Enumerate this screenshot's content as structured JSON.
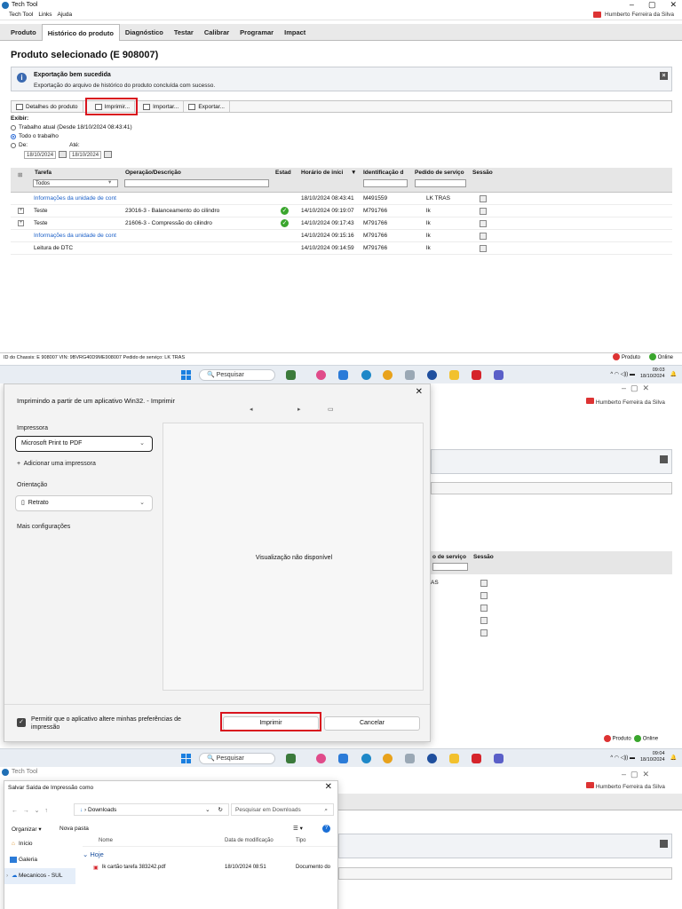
{
  "app": {
    "title": "Tech Tool",
    "window_controls": [
      "–",
      "▢",
      "✕"
    ],
    "menu": [
      "Tech Tool",
      "Links",
      "Ajuda"
    ],
    "user": "Humberto Ferreira da Silva",
    "tabs": [
      "Produto",
      "Histórico do produto",
      "Diagnóstico",
      "Testar",
      "Calibrar",
      "Programar",
      "Impact"
    ],
    "active_tab": "Histórico do produto",
    "page_title": "Produto selecionado (E 908007)",
    "notice": {
      "title": "Exportação bem sucedida",
      "message": "Exportação do arquivo de histórico do produto concluída com sucesso."
    },
    "toolbar": [
      "Detalhes do produto",
      "Imprimir...",
      "Importar...",
      "Exportar..."
    ],
    "exibir": {
      "label": "Exibir:",
      "opt1": "Trabalho atual (Desde 18/10/2024 08:43:41)",
      "opt2": "Todo o trabalho",
      "opt3": "De:",
      "ate": "Até:",
      "from_date": "18/10/2024",
      "to_date": "18/10/2024",
      "selected": "Todo o trabalho"
    },
    "grid": {
      "headers": [
        "Tarefa",
        "Operação/Descrição",
        "Estado",
        "Horário de início",
        "Identificação do",
        "Pedido de serviço",
        "Sessão"
      ],
      "header_display": [
        "Tarefa",
        "Operação/Descrição",
        "Estad",
        "Horário de iníci",
        "Identificação d",
        "Pedido de serviço",
        "Sessão"
      ],
      "filter_tarefa": "Todos",
      "rows": [
        {
          "tarefa": "Informações da unidade de cont",
          "op": "",
          "ok": false,
          "time": "18/10/2024 08:43:41",
          "id": "M491559",
          "pedido": "LK TRAS",
          "link": true
        },
        {
          "tarefa": "Teste",
          "op": "23016-3 - Balanceamento do cilindro",
          "ok": true,
          "time": "14/10/2024 09:19:07",
          "id": "M791766",
          "pedido": "lk",
          "link": false
        },
        {
          "tarefa": "Teste",
          "op": "21606-3 - Compressão do cilindro",
          "ok": true,
          "time": "14/10/2024 09:17:43",
          "id": "M791766",
          "pedido": "lk",
          "link": false
        },
        {
          "tarefa": "Informações da unidade de cont",
          "op": "",
          "ok": false,
          "time": "14/10/2024 09:15:16",
          "id": "M791766",
          "pedido": "lk",
          "link": true
        },
        {
          "tarefa": "Leitura de DTC",
          "op": "",
          "ok": false,
          "time": "14/10/2024 09:14:59",
          "id": "M791766",
          "pedido": "lk",
          "link": false
        }
      ]
    },
    "statusbar": {
      "left": "ID do Chassis: E 908007    VIN: 9BVRG40D9ME908007    Pedido de serviço: LK TRAS",
      "produto": "Produto",
      "online": "Online"
    }
  },
  "taskbar": {
    "search_placeholder": "Pesquisar",
    "time1": "09:03",
    "time2": "09:04",
    "date": "18/10/2024"
  },
  "print_dialog": {
    "title": "Imprimindo a partir de um aplicativo Win32. - Imprimir",
    "printer_label": "Impressora",
    "printer": "Microsoft Print to PDF",
    "add_printer": "Adicionar uma impressora",
    "orientation_label": "Orientação",
    "orientation": "Retrato",
    "more_settings": "Mais configurações",
    "preview": "Visualização não disponível",
    "allow_prefs": "Permitir que o aplicativo altere minhas preferências de impressão",
    "print_button": "Imprimir",
    "cancel_button": "Cancelar"
  },
  "bg_fragments": {
    "pedido": "o de serviço",
    "sessao": "Sessão",
    "lk": "AS"
  },
  "save_dialog": {
    "title": "Salvar Saída de Impressão como",
    "path": "Downloads",
    "search_placeholder": "Pesquisar em Downloads",
    "organize": "Organizar ▾",
    "new_folder": "Nova pasta",
    "sidebar": [
      "Início",
      "Galeria",
      "Mecanicos - SUL"
    ],
    "columns": [
      "Nome",
      "Data de modificação",
      "Tipo"
    ],
    "group": "Hoje",
    "file": {
      "name": "lk cartão tarefa 383242.pdf",
      "date": "18/10/2024 08:51",
      "type": "Documento do"
    }
  }
}
